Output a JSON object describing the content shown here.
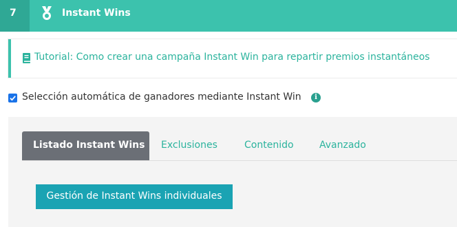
{
  "header": {
    "step_number": "7",
    "icon": "medal-icon",
    "title": "Instant Wins"
  },
  "tutorial": {
    "icon": "book-icon",
    "link_text": "Tutorial: Como crear una campaña Instant Win para repartir premios instantáneos"
  },
  "auto_selection": {
    "checked": true,
    "label": "Selección automática de ganadores mediante Instant Win",
    "info_icon": "info-icon",
    "info_glyph": "i"
  },
  "tabs": [
    {
      "label": "Listado Instant Wins",
      "active": true
    },
    {
      "label": "Exclusiones",
      "active": false
    },
    {
      "label": "Contenido",
      "active": false
    },
    {
      "label": "Avanzado",
      "active": false
    }
  ],
  "actions": {
    "manage_label": "Gestión de Instant Wins individuales"
  },
  "colors": {
    "accent": "#3cc2ad",
    "accent_dark": "#2fa895",
    "link": "#2bb39d",
    "active_tab": "#6b6f76",
    "button": "#1aa3b3",
    "checkbox": "#1a73e8"
  }
}
